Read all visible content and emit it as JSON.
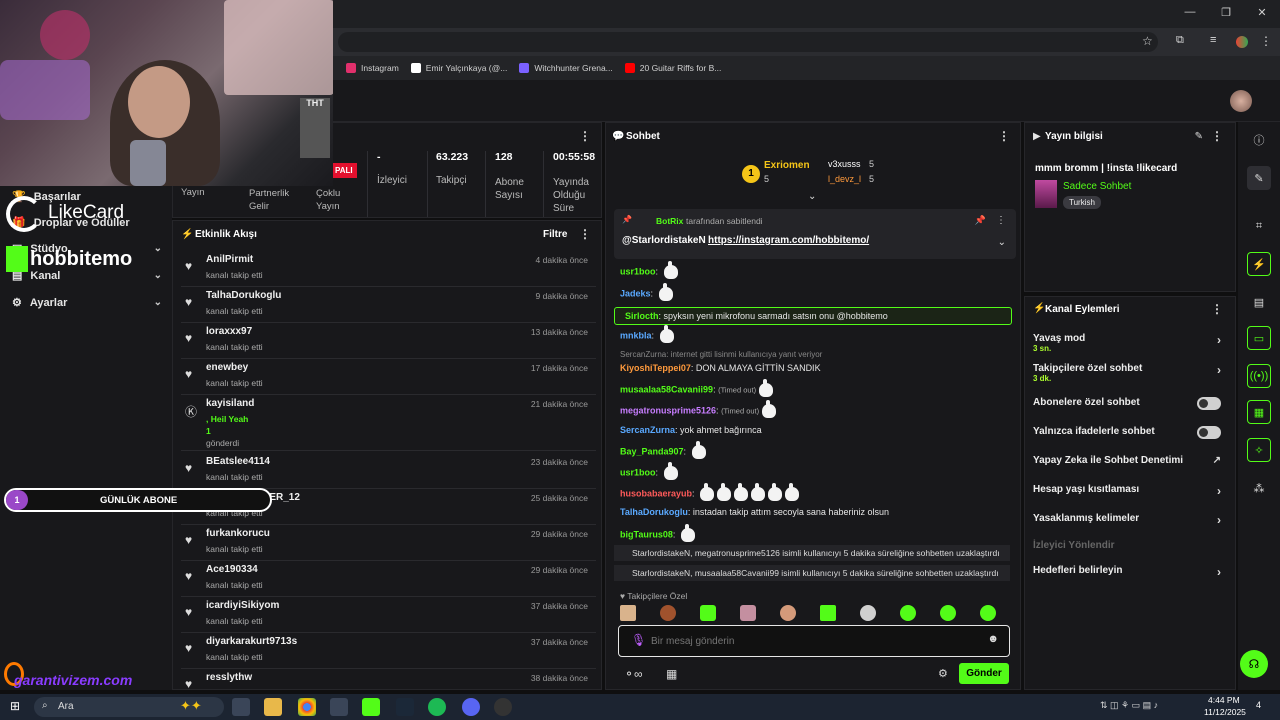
{
  "bookmarks": [
    {
      "label": "Instagram",
      "color": "#e1306c"
    },
    {
      "label": "Emir Yalçınkaya (@...",
      "color": "#ffffff"
    },
    {
      "label": "Witchhunter Grena...",
      "color": "#7b61ff"
    },
    {
      "label": "20 Guitar Riffs for B...",
      "color": "#ff0000"
    }
  ],
  "overlays": {
    "likecard": "LikeCard",
    "hobbitemo": "hobbitemo",
    "garanti": "garantivizem.com",
    "abone_count": "1",
    "abone_label": "GÜNLÜK ABONE",
    "webcam_sign": "THT"
  },
  "leftnav": {
    "items": [
      {
        "label": "Başarılar"
      },
      {
        "label": "Droplar ve Ödüller"
      },
      {
        "label": "Stüdyo"
      },
      {
        "label": "Kanal"
      },
      {
        "label": "Ayarlar"
      }
    ]
  },
  "stats": {
    "partial_label": "PALI",
    "labels_left": [
      "Yayın",
      "Partnerlik Gelir",
      "Çoklu Yayın"
    ],
    "cols": [
      {
        "value": "-",
        "label": "İzleyici"
      },
      {
        "value": "63.223",
        "label": "Takipçi"
      },
      {
        "value": "128",
        "label": "Abone Sayısı"
      },
      {
        "value": "00:55:58",
        "label": "Yayında Olduğu Süre"
      }
    ]
  },
  "activity": {
    "title": "Etkinlik Akışı",
    "filter": "Filtre",
    "rows": [
      {
        "name": "AnilPirmit",
        "sub": "kanalı takip etti",
        "time": "4 dakika önce"
      },
      {
        "name": "TalhaDorukoglu",
        "sub": "kanalı takip etti",
        "time": "9 dakika önce"
      },
      {
        "name": "loraxxx97",
        "sub": "kanalı takip etti",
        "time": "13 dakika önce"
      },
      {
        "name": "enewbey",
        "sub": "kanalı takip etti",
        "time": "17 dakika önce"
      },
      {
        "name": "kayisiland",
        "sub": ", Heil Yeah",
        "extra": "1",
        "extra2": "gönderdi",
        "time": "21 dakika önce"
      },
      {
        "name": "BEatslee4114",
        "sub": "kanalı takip etti",
        "time": "23 dakika önce"
      },
      {
        "name": "THE_PUNISHER_12",
        "sub": "kanalı takip etti",
        "time": "25 dakika önce"
      },
      {
        "name": "furkankorucu",
        "sub": "kanalı takip etti",
        "time": "29 dakika önce"
      },
      {
        "name": "Ace190334",
        "sub": "kanalı takip etti",
        "time": "29 dakika önce"
      },
      {
        "name": "icardiyiSikiyom",
        "sub": "kanalı takip etti",
        "time": "37 dakika önce"
      },
      {
        "name": "diyarkarakurt9713s",
        "sub": "kanalı takip etti",
        "time": "37 dakika önce"
      },
      {
        "name": "resslythw",
        "sub": "",
        "time": "38 dakika önce"
      }
    ]
  },
  "chat": {
    "title": "Sohbet",
    "top": {
      "user1": "Exriomen",
      "user1_count": "5",
      "user2": "v3xusss",
      "user2_count": "5",
      "user3": "l_devz_l",
      "user3_count": "5"
    },
    "pinned": {
      "by": "BotRix",
      "by_suffix": "tarafından sabitlendi",
      "user": "@StarlordistakeN",
      "link": "https://instagram.com/hobbitemo/"
    },
    "messages": [
      {
        "user": "usr1boo",
        "color": "#53fc18",
        "text": ""
      },
      {
        "user": "Jadeks",
        "color": "#5aa9ff",
        "text": ""
      },
      {
        "user": "Sirlocth",
        "color": "#53fc18",
        "text": "spyksın yeni mikrofonu sarmadı satsın onu @hobbitemo"
      },
      {
        "user": "mnkbla",
        "color": "#5aa9ff",
        "text": ""
      },
      {
        "user": "",
        "color": "#999",
        "text": "SercanZurna: internet gitti lisinmi kullanıcıya yanıt veriyor"
      },
      {
        "user": "KiyoshiTeppei07",
        "color": "#ff9a3c",
        "text": "DON ALMAYA GİTTİN SANDIK"
      },
      {
        "user": "musaalaa58Cavanii99",
        "color": "#53fc18",
        "text": "(Timed out)"
      },
      {
        "user": "megatronusprime5126",
        "color": "#c77dff",
        "text": "(Timed out)"
      },
      {
        "user": "SercanZurna",
        "color": "#5aa9ff",
        "text": "yok ahmet bağırınca"
      },
      {
        "user": "Bay_Panda907",
        "color": "#53fc18",
        "text": ""
      },
      {
        "user": "usr1boo",
        "color": "#53fc18",
        "text": ""
      },
      {
        "user": "husobabaerayub",
        "color": "#ff5a5a",
        "text": ""
      },
      {
        "user": "TalhaDorukoglu",
        "color": "#5aa9ff",
        "text": "instadan takip attım secoyla sana haberiniz olsun"
      },
      {
        "user": "bigTaurus08",
        "color": "#53fc18",
        "text": ""
      }
    ],
    "system": [
      "StarlordistakeN, megatronusprime5126 isimli kullanıcıyı 5 dakika süreliğine sohbetten uzaklaştırdı",
      "StarlordistakeN, musaalaa58Cavanii99 isimli kullanıcıyı 5 dakika süreliğine sohbetten uzaklaştırdı"
    ],
    "followers_only": "Takipçilere Özel",
    "input_placeholder": "Bir mesaj gönderin",
    "send": "Gönder"
  },
  "info": {
    "title": "Yayın bilgisi",
    "stream_title": "mmm bromm | !insta !likecard",
    "category": "Sadece Sohbet",
    "language": "Turkish"
  },
  "actions": {
    "title": "Kanal Eylemleri",
    "items": [
      {
        "label": "Yavaş mod",
        "small": "3 sn.",
        "type": "arrow"
      },
      {
        "label": "Takipçilere özel sohbet",
        "small": "3 dk.",
        "type": "arrow"
      },
      {
        "label": "Abonelere özel sohbet",
        "type": "toggle"
      },
      {
        "label": "Yalnızca ifadelerle sohbet",
        "type": "toggle"
      },
      {
        "label": "Yapay Zeka ile Sohbet Denetimi",
        "type": "ext"
      },
      {
        "label": "Hesap yaşı kısıtlaması",
        "type": "arrow"
      },
      {
        "label": "Yasaklanmış kelimeler",
        "type": "arrow"
      },
      {
        "label": "İzleyici Yönlendir",
        "type": "disabled"
      },
      {
        "label": "Hedefleri belirleyin",
        "type": "arrow"
      }
    ]
  },
  "taskbar": {
    "search": "Ara",
    "time": "4:44 PM",
    "date": "11/12/2025",
    "notif": "4"
  },
  "colors": {
    "accent": "#53fc18",
    "bg": "#18181b"
  }
}
